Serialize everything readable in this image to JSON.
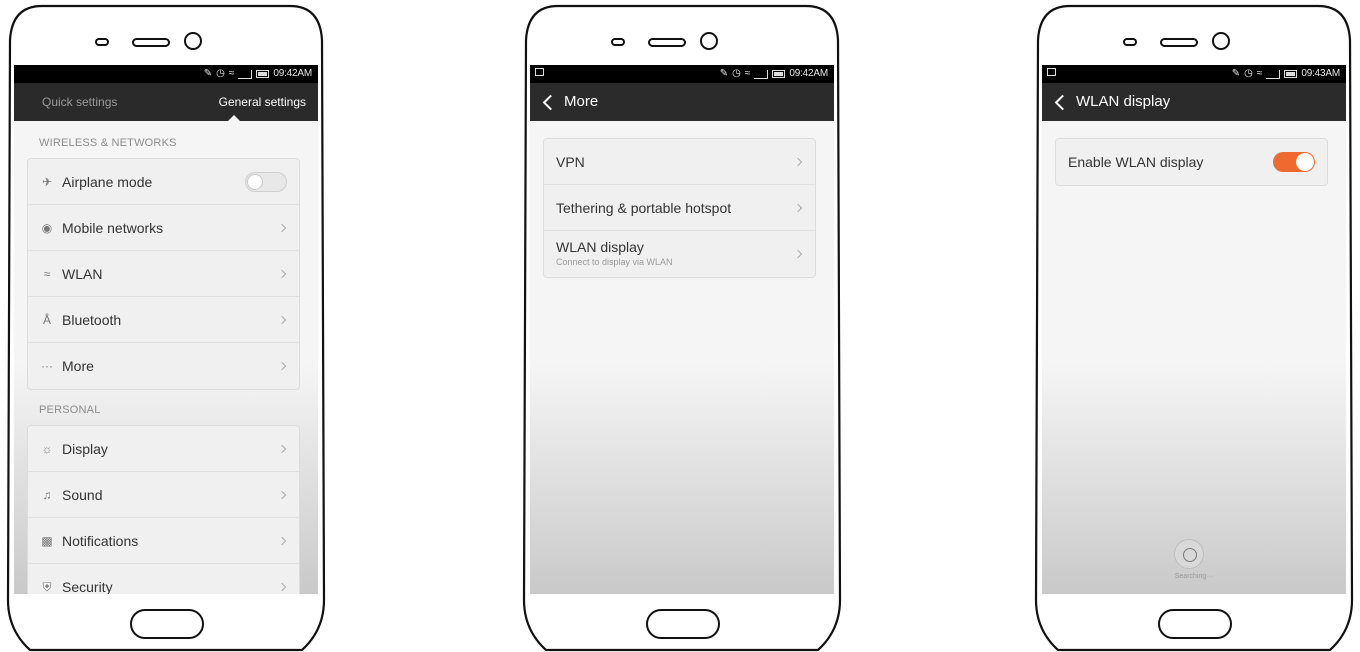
{
  "colors": {
    "statusbar": "#000000",
    "actionbar": "#2b2b2b",
    "screen_bg": "#f5f5f5",
    "toggle_on": "#f06a2f"
  },
  "phone1": {
    "status": {
      "time": "09:42AM",
      "icons": [
        "mute-icon",
        "alarm-icon",
        "wifi-icon",
        "signal-icon",
        "battery-icon"
      ]
    },
    "tabs": {
      "quick": "Quick settings",
      "general": "General settings",
      "selected": "General settings"
    },
    "sections": [
      {
        "title": "WIRELESS & NETWORKS",
        "items": [
          {
            "icon": "airplane-icon",
            "label": "Airplane mode",
            "control": "toggle",
            "toggle_on": false
          },
          {
            "icon": "mobile-network-icon",
            "label": "Mobile networks",
            "control": "chevron"
          },
          {
            "icon": "wifi-icon",
            "label": "WLAN",
            "control": "chevron"
          },
          {
            "icon": "bluetooth-icon",
            "label": "Bluetooth",
            "control": "chevron"
          },
          {
            "icon": "more-dots-icon",
            "label": "More",
            "control": "chevron"
          }
        ]
      },
      {
        "title": "PERSONAL",
        "items": [
          {
            "icon": "display-icon",
            "label": "Display",
            "control": "chevron"
          },
          {
            "icon": "sound-icon",
            "label": "Sound",
            "control": "chevron"
          },
          {
            "icon": "notifications-icon",
            "label": "Notifications",
            "control": "chevron"
          },
          {
            "icon": "security-icon",
            "label": "Security",
            "control": "chevron"
          }
        ]
      }
    ]
  },
  "phone2": {
    "status": {
      "time": "09:42AM",
      "icons": [
        "screenshot-icon",
        "mute-icon",
        "alarm-icon",
        "wifi-icon",
        "signal-icon",
        "battery-icon"
      ]
    },
    "title": "More",
    "items": [
      {
        "label": "VPN"
      },
      {
        "label": "Tethering & portable hotspot"
      },
      {
        "label": "WLAN display",
        "sublabel": "Connect to display via WLAN"
      }
    ]
  },
  "phone3": {
    "status": {
      "time": "09:43AM",
      "icons": [
        "screenshot-icon",
        "mute-icon",
        "alarm-icon",
        "wifi-icon",
        "signal-icon",
        "battery-icon"
      ]
    },
    "title": "WLAN display",
    "enable": {
      "label": "Enable WLAN display",
      "toggle_on": true
    },
    "searching": "Searching···"
  }
}
